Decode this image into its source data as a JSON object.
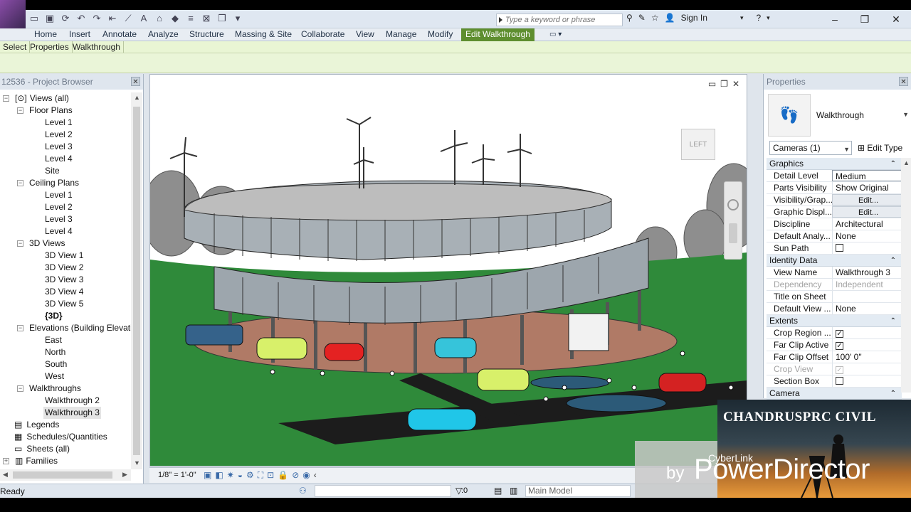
{
  "window": {
    "sign_in": "Sign In"
  },
  "search": {
    "placeholder": "Type a keyword or phrase"
  },
  "ribbon": {
    "tabs": [
      "Home",
      "Insert",
      "Annotate",
      "Analyze",
      "Structure",
      "Massing & Site",
      "Collaborate",
      "View",
      "Manage",
      "Modify",
      "Edit Walkthrough"
    ],
    "active_tab": "Edit Walkthrough",
    "context": [
      "Select",
      "Properties",
      "Walkthrough"
    ]
  },
  "project_browser": {
    "title": "12536 - Project Browser",
    "tree": [
      "Views (all)",
      "Floor Plans",
      "Level 1",
      "Level 2",
      "Level 3",
      "Level 4",
      "Site",
      "Ceiling Plans",
      "Level 1",
      "Level 2",
      "Level 3",
      "Level 4",
      "3D Views",
      "3D View 1",
      "3D View 2",
      "3D View 3",
      "3D View 4",
      "3D View 5",
      "{3D}",
      "Elevations (Building Elevatio",
      "East",
      "North",
      "South",
      "West",
      "Walkthroughs",
      "Walkthrough 2",
      "Walkthrough 3",
      "Legends",
      "Schedules/Quantities",
      "Sheets (all)",
      "Families"
    ],
    "selected": "Walkthrough 3"
  },
  "viewport": {
    "viewcube_label": "LEFT",
    "scale": "1/8\" = 1'-0\""
  },
  "properties": {
    "title": "Properties",
    "type_name": "Walkthrough",
    "filter": "Cameras (1)",
    "edit_type": "Edit Type",
    "groups": {
      "graphics": "Graphics",
      "identity": "Identity Data",
      "extents": "Extents",
      "camera": "Camera"
    },
    "rows": {
      "detail_level": [
        "Detail Level",
        "Medium"
      ],
      "parts_visibility": [
        "Parts Visibility",
        "Show Original"
      ],
      "vis_graphics": [
        "Visibility/Grap...",
        "Edit..."
      ],
      "graphic_display": [
        "Graphic Displ...",
        "Edit..."
      ],
      "discipline": [
        "Discipline",
        "Architectural"
      ],
      "default_analysis": [
        "Default Analy...",
        "None"
      ],
      "sun_path": [
        "Sun Path",
        ""
      ],
      "view_name": [
        "View Name",
        "Walkthrough 3"
      ],
      "dependency": [
        "Dependency",
        "Independent"
      ],
      "title_on_sheet": [
        "Title on Sheet",
        ""
      ],
      "default_view": [
        "Default View ...",
        "None"
      ],
      "crop_region": [
        "Crop Region ...",
        ""
      ],
      "far_clip_active": [
        "Far Clip Active",
        ""
      ],
      "far_clip_offset": [
        "Far Clip Offset",
        "100'  0\""
      ],
      "crop_view": [
        "Crop View",
        ""
      ],
      "section_box": [
        "Section Box",
        ""
      ]
    }
  },
  "statusbar": {
    "status": "Ready",
    "filter_count": ":0",
    "model": "Main Model"
  },
  "watermark": {
    "channel": "CHANDRUSPRC CIVIL",
    "cyber": "CyberLink",
    "by": "by",
    "product": "PowerDirector"
  }
}
